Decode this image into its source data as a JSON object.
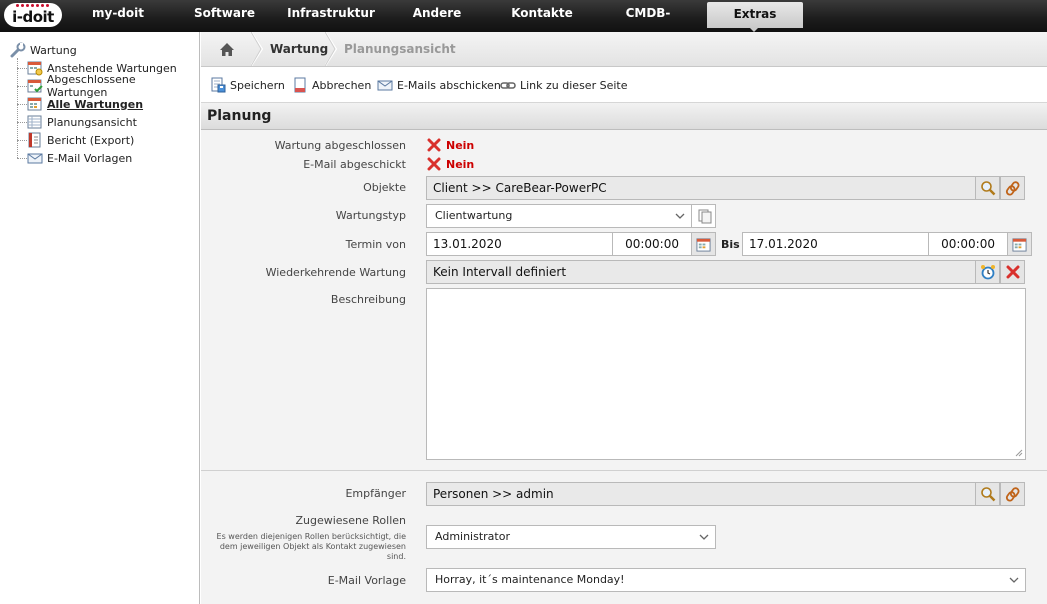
{
  "nav": {
    "logo": "i-doit",
    "items": [
      "my-doit",
      "Software",
      "Infrastruktur",
      "Andere",
      "Kontakte",
      "CMDB-Explorer",
      "Extras"
    ],
    "active": "Extras"
  },
  "tree": {
    "root": "Wartung",
    "items": [
      "Anstehende Wartungen",
      "Abgeschlossene Wartungen",
      "Alle Wartungen",
      "Planungsansicht",
      "Bericht (Export)",
      "E-Mail Vorlagen"
    ],
    "active": "Alle Wartungen"
  },
  "breadcrumb": {
    "items": [
      "Wartung",
      "Planungsansicht"
    ]
  },
  "toolbar": {
    "save": "Speichern",
    "cancel": "Abbrechen",
    "send_mails": "E-Mails abschicken",
    "link": "Link zu dieser Seite"
  },
  "section": {
    "title": "Planung"
  },
  "form": {
    "completed_label": "Wartung abgeschlossen",
    "completed_value": "Nein",
    "mail_sent_label": "E-Mail abgeschickt",
    "mail_sent_value": "Nein",
    "objects_label": "Objekte",
    "objects_value": "Client >> CareBear-PowerPC",
    "type_label": "Wartungstyp",
    "type_value": "Clientwartung",
    "date_label": "Termin von",
    "date_from": "13.01.2020",
    "time_from": "00:00:00",
    "bis": "Bis",
    "date_to": "17.01.2020",
    "time_to": "00:00:00",
    "recurring_label": "Wiederkehrende Wartung",
    "recurring_value": "Kein Intervall definiert",
    "description_label": "Beschreibung",
    "recipients_label": "Empfänger",
    "recipients_value": "Personen >> admin",
    "roles_label": "Zugewiesene Rollen",
    "roles_hint": "Es werden diejenigen Rollen berücksichtigt, die dem jeweiligen Objekt als Kontakt zugewiesen sind.",
    "roles_value": "Administrator",
    "template_label": "E-Mail Vorlage",
    "template_value": "Horray, it´s maintenance Monday!"
  },
  "colors": {
    "nav_bg": "#1c1c1c",
    "accent_red": "#c8102e",
    "no_red": "#cc0000"
  }
}
